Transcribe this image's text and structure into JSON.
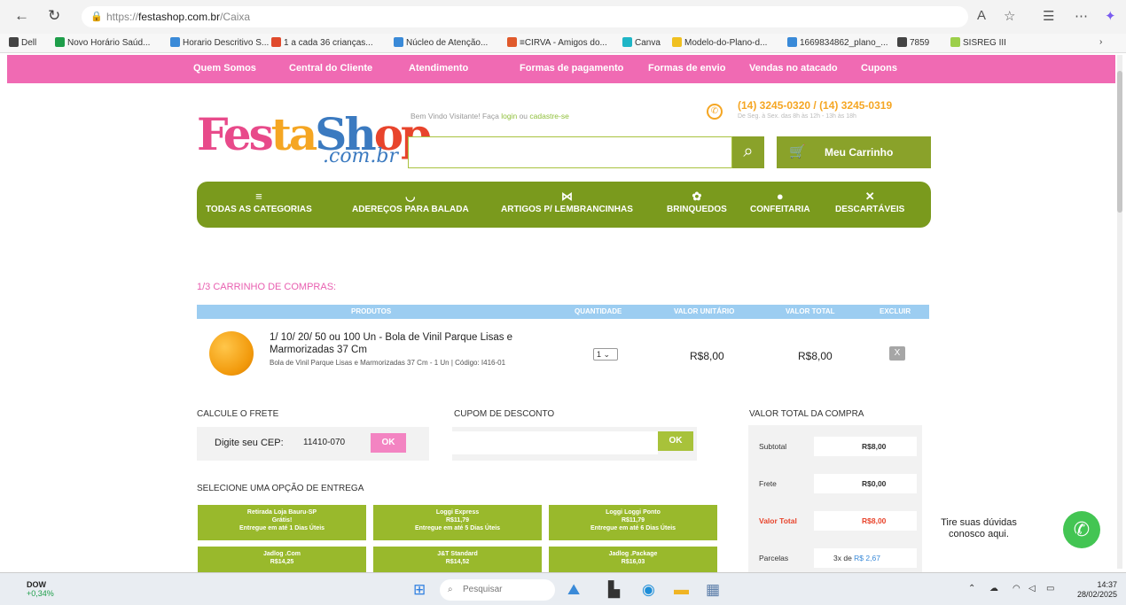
{
  "browser": {
    "url_prefix": "https://",
    "url_host": "festashop.com.br",
    "url_path": "/Caixa",
    "bookmarks": [
      {
        "label": "Dell",
        "color": "#444"
      },
      {
        "label": "Novo Horário Saúd...",
        "color": "#1e9e4a"
      },
      {
        "label": "Horario Descritivo S...",
        "color": "#3a8ad8"
      },
      {
        "label": "1 a cada 36 crianças...",
        "color": "#e04a2c"
      },
      {
        "label": "Núcleo de Atenção...",
        "color": "#3a8ad8"
      },
      {
        "label": "≡CIRVA - Amigos do...",
        "color": "#e05a2c"
      },
      {
        "label": "Canva",
        "color": "#1fb5c6"
      },
      {
        "label": "Modelo-do-Plano-d...",
        "color": "#f0c020"
      },
      {
        "label": "1669834862_plano_...",
        "color": "#3a8ad8"
      },
      {
        "label": "7859",
        "color": "#444"
      },
      {
        "label": "SISREG III",
        "color": "#9ccf4a"
      }
    ]
  },
  "topnav": [
    "Quem Somos",
    "Central do Cliente",
    "Atendimento",
    "Formas de pagamento",
    "Formas de envio",
    "Vendas no atacado",
    "Cupons"
  ],
  "header": {
    "logo_main": "FestaShop",
    "logo_sub": ".com.br",
    "welcome": "Bem Vindo Visitante!   Faça",
    "login": "login",
    "or": "ou",
    "register": "cadastre-se",
    "phone": "(14) 3245-0320 / (14) 3245-0319",
    "hours": "De Seg. à Sex. das 8h às 12h - 13h às 18h",
    "cart_label": "Meu Carrinho"
  },
  "categories": [
    {
      "label": "TODAS AS CATEGORIAS",
      "icon": "≡"
    },
    {
      "label": "ADEREÇOS PARA BALADA",
      "icon": "◡"
    },
    {
      "label": "ARTIGOS P/ LEMBRANCINHAS",
      "icon": "⋈"
    },
    {
      "label": "BRINQUEDOS",
      "icon": "✿"
    },
    {
      "label": "CONFEITARIA",
      "icon": "●"
    },
    {
      "label": "DESCARTÁVEIS",
      "icon": "✕"
    }
  ],
  "cart": {
    "step_title": "1/3 CARRINHO DE COMPRAS:",
    "columns": [
      "PRODUTOS",
      "QUANTIDADE",
      "VALOR UNITÁRIO",
      "VALOR TOTAL",
      "EXCLUIR"
    ],
    "item": {
      "name": "1/ 10/ 20/ 50 ou 100 Un - Bola de Vinil Parque Lisas e Marmorizadas 37 Cm",
      "desc": "Bola de Vinil Parque Lisas e Marmorizadas 37 Cm - 1 Un | Código: I416-01",
      "qty": "1",
      "unit": "R$8,00",
      "total": "R$8,00",
      "delete": "X"
    }
  },
  "shipping": {
    "title": "CALCULE O FRETE",
    "cep_label": "Digite seu CEP:",
    "cep_value": "11410-070",
    "ok": "OK"
  },
  "coupon": {
    "title": "CUPOM DE DESCONTO",
    "ok": "OK"
  },
  "delivery": {
    "title": "SELECIONE UMA OPÇÃO DE ENTREGA",
    "options": [
      {
        "l1": "Retirada Loja Bauru-SP",
        "l2": "Grátis!",
        "l3": "Entregue em até 1 Dias Úteis"
      },
      {
        "l1": "Loggi Express",
        "l2": "R$11,79",
        "l3": "Entregue em até 5 Dias Úteis"
      },
      {
        "l1": "Loggi Loggi Ponto",
        "l2": "R$11,79",
        "l3": "Entregue em até 6 Dias Úteis"
      },
      {
        "l1": "Jadlog .Com",
        "l2": "R$14,25",
        "l3": ""
      },
      {
        "l1": "J&T Standard",
        "l2": "R$14,52",
        "l3": ""
      },
      {
        "l1": "Jadlog .Package",
        "l2": "R$16,03",
        "l3": ""
      }
    ]
  },
  "summary": {
    "title": "VALOR TOTAL DA COMPRA",
    "subtotal_label": "Subtotal",
    "subtotal": "R$8,00",
    "frete_label": "Frete",
    "frete": "R$0,00",
    "total_label": "Valor Total",
    "total": "R$8,00",
    "parcelas_label": "Parcelas",
    "parcelas_prefix": "3x de",
    "parcelas_value": "R$ 2,67"
  },
  "help_text": "Tire suas dúvidas conosco aqui.",
  "taskbar": {
    "stock_name": "DOW",
    "stock_change": "+0,34%",
    "search_placeholder": "Pesquisar",
    "time": "14:37",
    "date": "28/02/2025"
  }
}
